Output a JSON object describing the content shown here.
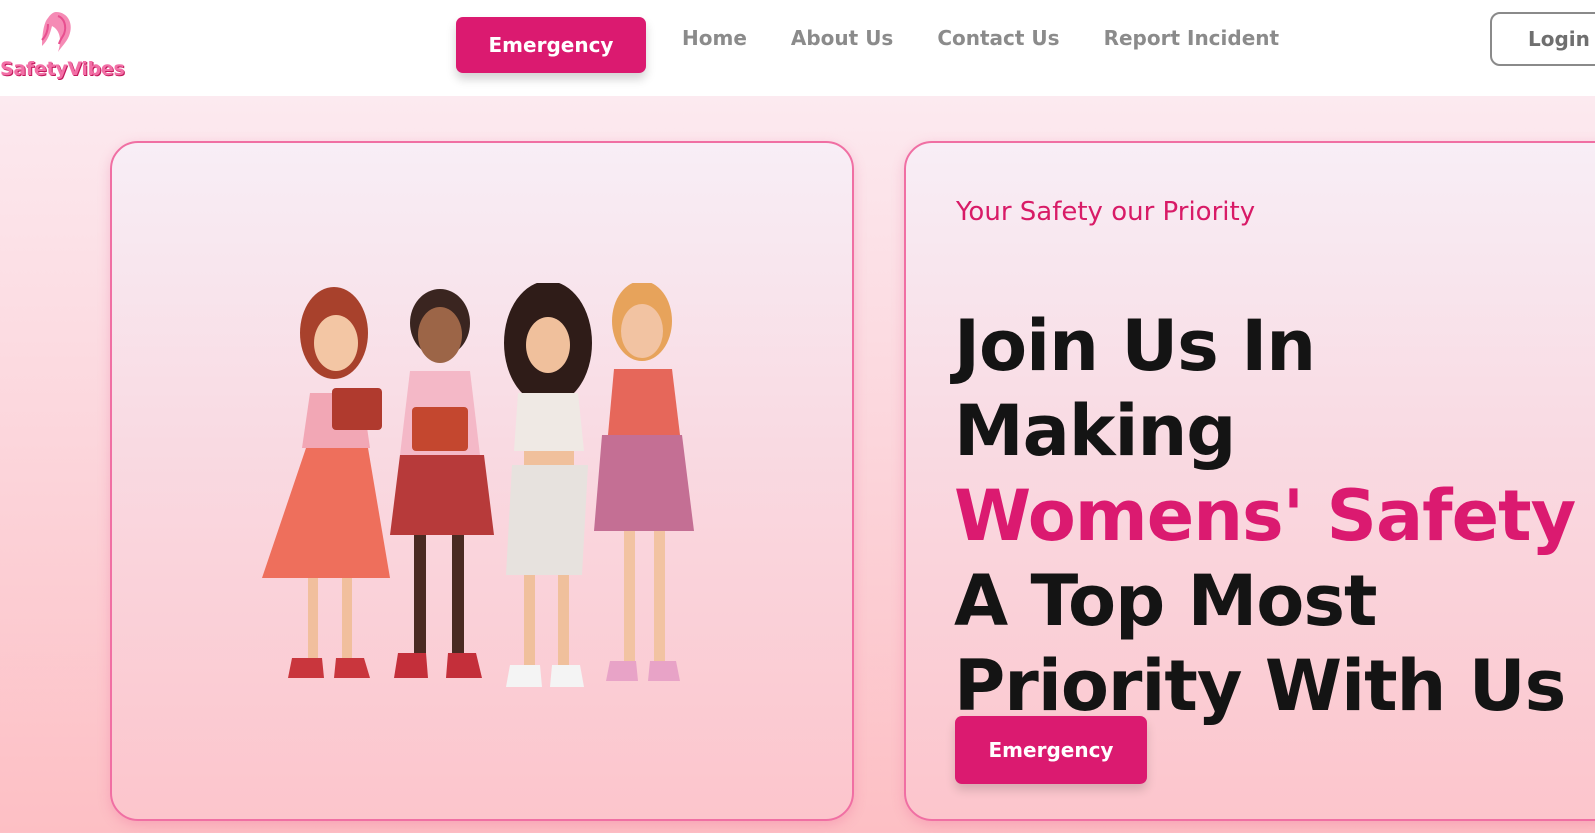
{
  "brand": {
    "name": "SafetyVibes",
    "color": "#f26fa6"
  },
  "nav": {
    "emergency_label": "Emergency",
    "links": [
      "Home",
      "About Us",
      "Contact Us",
      "Report Incident"
    ],
    "login_label": "Login"
  },
  "hero": {
    "tagline": "Your Safety our Priority",
    "headline": {
      "line1": "Join Us In",
      "line2": "Making",
      "line3": "Womens' Safety",
      "line4": "A Top Most",
      "line5": "Priority With Us"
    },
    "emergency_label": "Emergency",
    "illustration_icon": "four-women-illustration"
  },
  "colors": {
    "accent": "#db1a70",
    "text": "#141414",
    "nav_text": "#8b8b8b"
  }
}
